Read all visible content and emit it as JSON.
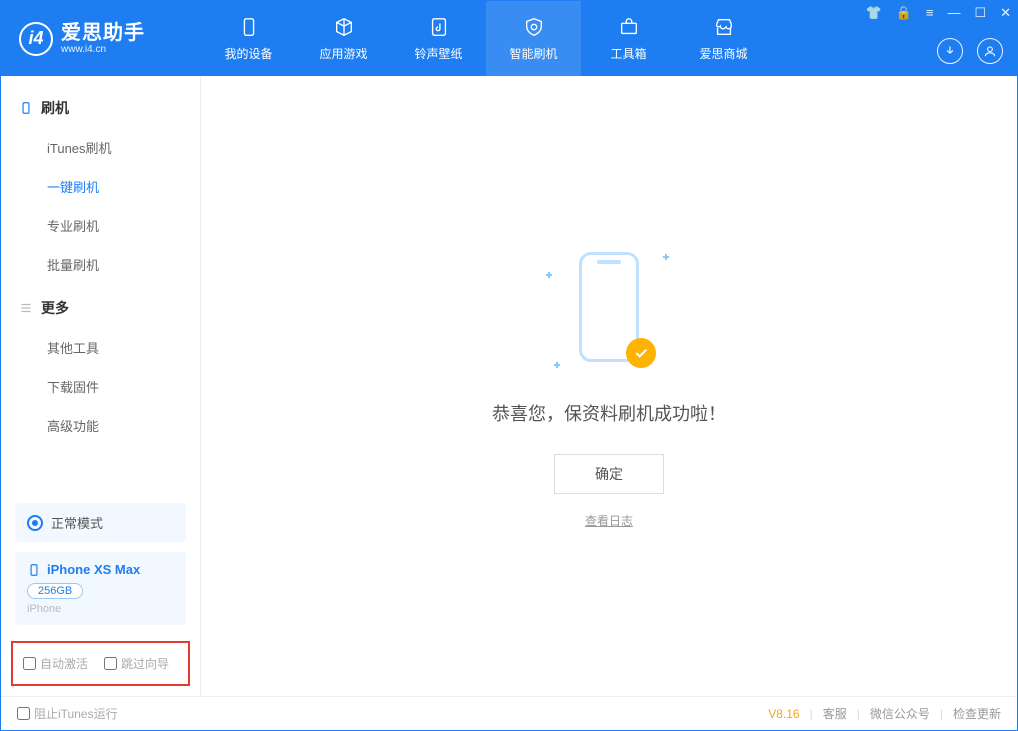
{
  "brand": {
    "name": "爱思助手",
    "url": "www.i4.cn"
  },
  "tabs": [
    {
      "label": "我的设备",
      "active": false
    },
    {
      "label": "应用游戏",
      "active": false
    },
    {
      "label": "铃声壁纸",
      "active": false
    },
    {
      "label": "智能刷机",
      "active": true
    },
    {
      "label": "工具箱",
      "active": false
    },
    {
      "label": "爱思商城",
      "active": false
    }
  ],
  "sidebar": {
    "groups": [
      {
        "title": "刷机",
        "items": [
          {
            "label": "iTunes刷机",
            "active": false
          },
          {
            "label": "一键刷机",
            "active": true
          },
          {
            "label": "专业刷机",
            "active": false
          },
          {
            "label": "批量刷机",
            "active": false
          }
        ]
      },
      {
        "title": "更多",
        "items": [
          {
            "label": "其他工具",
            "active": false
          },
          {
            "label": "下载固件",
            "active": false
          },
          {
            "label": "高级功能",
            "active": false
          }
        ]
      }
    ],
    "mode_label": "正常模式",
    "device": {
      "name": "iPhone XS Max",
      "capacity": "256GB",
      "type": "iPhone"
    },
    "bottom_opts": {
      "auto_activate": "自动激活",
      "skip_guide": "跳过向导"
    }
  },
  "main": {
    "success_msg": "恭喜您，保资料刷机成功啦！",
    "ok_btn": "确定",
    "log_link": "查看日志"
  },
  "statusbar": {
    "block_itunes": "阻止iTunes运行",
    "version": "V8.16",
    "links": [
      "客服",
      "微信公众号",
      "检查更新"
    ]
  }
}
